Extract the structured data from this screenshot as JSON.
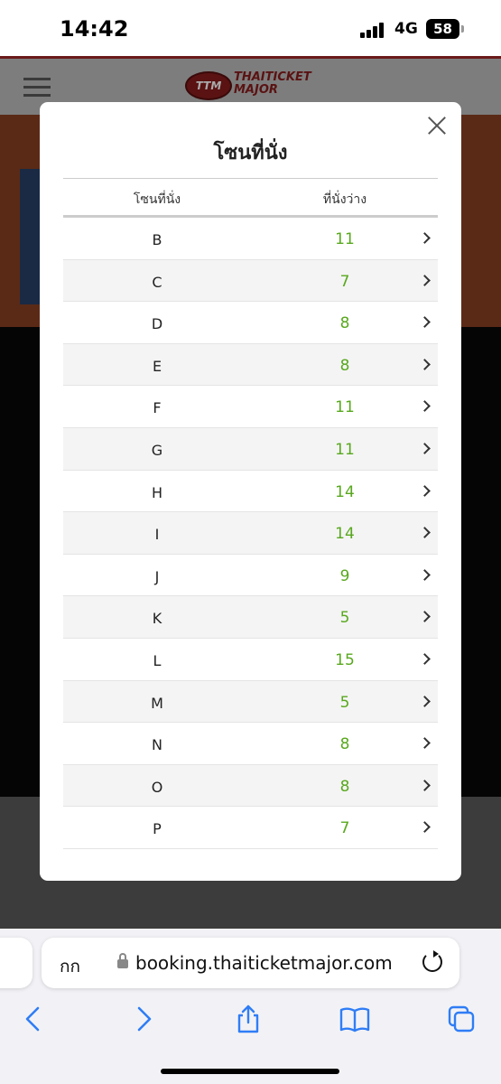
{
  "status_bar": {
    "time": "14:42",
    "network": "4G",
    "battery": "58"
  },
  "site": {
    "logo_mark": "TTM",
    "logo_text_line1": "THAITICKET",
    "logo_text_line2": "MAJOR"
  },
  "modal": {
    "title": "โซนที่นั่ง",
    "columns": {
      "zone": "โซนที่นั่ง",
      "available": "ที่นั่งว่าง"
    },
    "rows": [
      {
        "zone": "B",
        "available": "11"
      },
      {
        "zone": "C",
        "available": "7"
      },
      {
        "zone": "D",
        "available": "8"
      },
      {
        "zone": "E",
        "available": "8"
      },
      {
        "zone": "F",
        "available": "11"
      },
      {
        "zone": "G",
        "available": "11"
      },
      {
        "zone": "H",
        "available": "14"
      },
      {
        "zone": "I",
        "available": "14"
      },
      {
        "zone": "J",
        "available": "9"
      },
      {
        "zone": "K",
        "available": "5"
      },
      {
        "zone": "L",
        "available": "15"
      },
      {
        "zone": "M",
        "available": "5"
      },
      {
        "zone": "N",
        "available": "8"
      },
      {
        "zone": "O",
        "available": "8"
      },
      {
        "zone": "P",
        "available": "7"
      }
    ],
    "available_color": "#58a81d"
  },
  "browser": {
    "aa_label": "กก",
    "url": "booking.thaiticketmajor.com",
    "accent_color": "#2f7df6"
  }
}
